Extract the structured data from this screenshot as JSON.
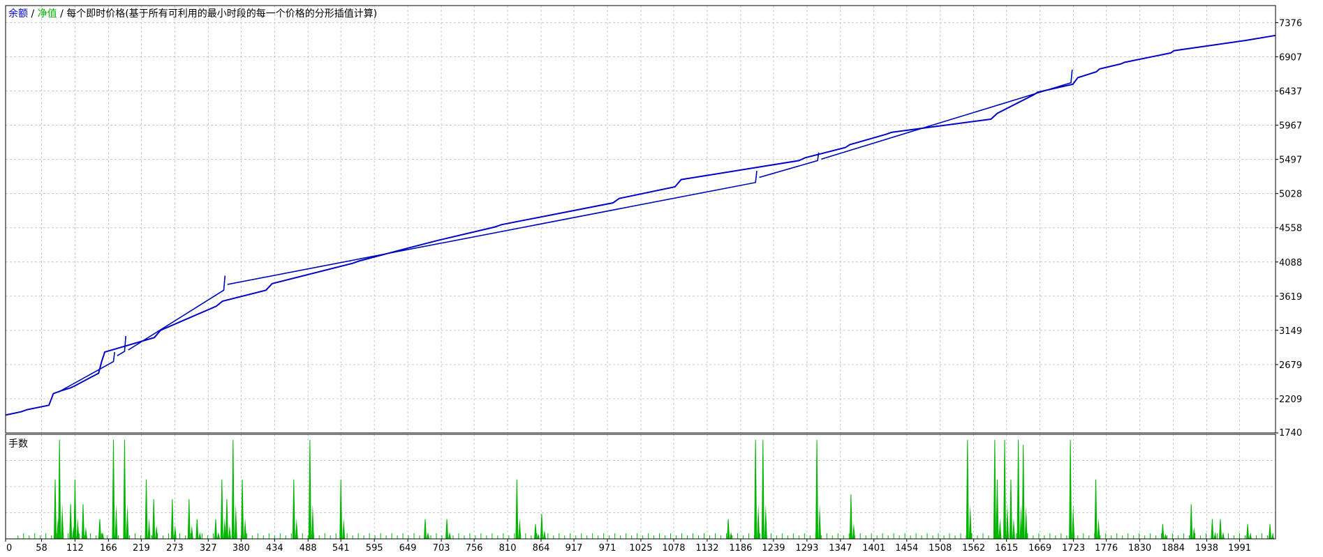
{
  "title": {
    "balance_label": "余额",
    "sep1": " / ",
    "equity_label": "净值",
    "sep2": " / ",
    "model_text": "每个即时价格(基于所有可利用的最小时段的每一个价格的分形插值计算)"
  },
  "volume_panel_label": "手数",
  "colors": {
    "balance": "#0000c8",
    "equity": "#00b400",
    "volume": "#00b400",
    "grid": "#c8c8c8",
    "frame": "#000000",
    "text": "#000000"
  },
  "chart_data": [
    {
      "type": "line",
      "title": "余额 / 净值 / 每个即时价格(基于所有可利用的最小时段的每一个价格的分形插值计算)",
      "series": [
        {
          "name": "余额",
          "x": [
            0,
            25,
            35,
            70,
            77,
            90,
            105,
            110,
            150,
            155,
            160,
            240,
            250,
            340,
            350,
            420,
            430,
            560,
            570,
            650,
            700,
            790,
            800,
            980,
            990,
            1080,
            1090,
            1280,
            1290,
            1355,
            1362,
            1420,
            1430,
            1590,
            1600,
            1660,
            1665,
            1722,
            1730,
            1760,
            1765,
            1800,
            1805,
            1880,
            1885,
            2000,
            2049
          ],
          "values": [
            1985,
            2030,
            2060,
            2120,
            2280,
            2320,
            2360,
            2380,
            2560,
            2720,
            2850,
            3050,
            3150,
            3480,
            3550,
            3700,
            3790,
            4070,
            4100,
            4280,
            4390,
            4570,
            4600,
            4900,
            4960,
            5120,
            5220,
            5480,
            5520,
            5660,
            5700,
            5840,
            5870,
            6050,
            6130,
            6390,
            6420,
            6530,
            6620,
            6700,
            6740,
            6810,
            6830,
            6960,
            6990,
            7130,
            7200
          ]
        },
        {
          "name": "净值",
          "x": [
            0,
            80,
            82,
            85,
            174,
            176,
            180,
            192,
            194,
            198,
            352,
            354,
            358,
            1210,
            1212,
            1216,
            1310,
            1312,
            1316,
            1719,
            1721,
            1725
          ],
          "values": [
            1985,
            2210,
            2400,
            2300,
            2720,
            2850,
            2800,
            2860,
            3070,
            2880,
            3700,
            3900,
            3780,
            5180,
            5340,
            5250,
            5480,
            5590,
            5500,
            6550,
            6730,
            6620
          ]
        }
      ],
      "xlim": [
        0,
        2049
      ],
      "ylim": [
        1740,
        7610
      ],
      "yticks": [
        7376,
        6907,
        6437,
        5967,
        5497,
        5028,
        4558,
        4088,
        3619,
        3149,
        2679,
        2209,
        1740
      ],
      "grid": true,
      "legend_position": "top-left"
    },
    {
      "type": "bar",
      "title": "手数",
      "x_spikes": [
        80,
        87,
        105,
        112,
        125,
        152,
        174,
        192,
        227,
        239,
        269,
        296,
        309,
        339,
        349,
        357,
        367,
        382,
        465,
        491,
        541,
        677,
        712,
        825,
        855,
        865,
        1166,
        1210,
        1222,
        1309,
        1364,
        1552,
        1596,
        1600,
        1612,
        1622,
        1634,
        1642,
        1718,
        1759,
        1867,
        1913,
        1947,
        1960,
        2004,
        2040
      ],
      "volumes": [
        0.6,
        1.0,
        0.35,
        0.6,
        0.35,
        0.2,
        1.0,
        1.0,
        0.6,
        0.4,
        0.4,
        0.4,
        0.2,
        0.2,
        0.6,
        0.4,
        1.0,
        0.6,
        0.6,
        1.0,
        0.6,
        0.2,
        0.2,
        0.6,
        0.15,
        0.25,
        0.2,
        1.0,
        1.0,
        1.0,
        0.45,
        1.0,
        1.0,
        0.6,
        1.0,
        0.6,
        1.0,
        0.95,
        1.0,
        0.6,
        0.15,
        0.35,
        0.2,
        0.2,
        0.15,
        0.15
      ],
      "x_ticks": [
        0,
        58,
        112,
        166,
        219,
        273,
        327,
        380,
        434,
        488,
        541,
        595,
        649,
        703,
        756,
        810,
        864,
        917,
        971,
        1025,
        1078,
        1132,
        1186,
        1239,
        1293,
        1347,
        1401,
        1454,
        1508,
        1562,
        1615,
        1669,
        1723,
        1776,
        1830,
        1884,
        1938,
        1991
      ],
      "xlim": [
        0,
        2049
      ]
    }
  ]
}
